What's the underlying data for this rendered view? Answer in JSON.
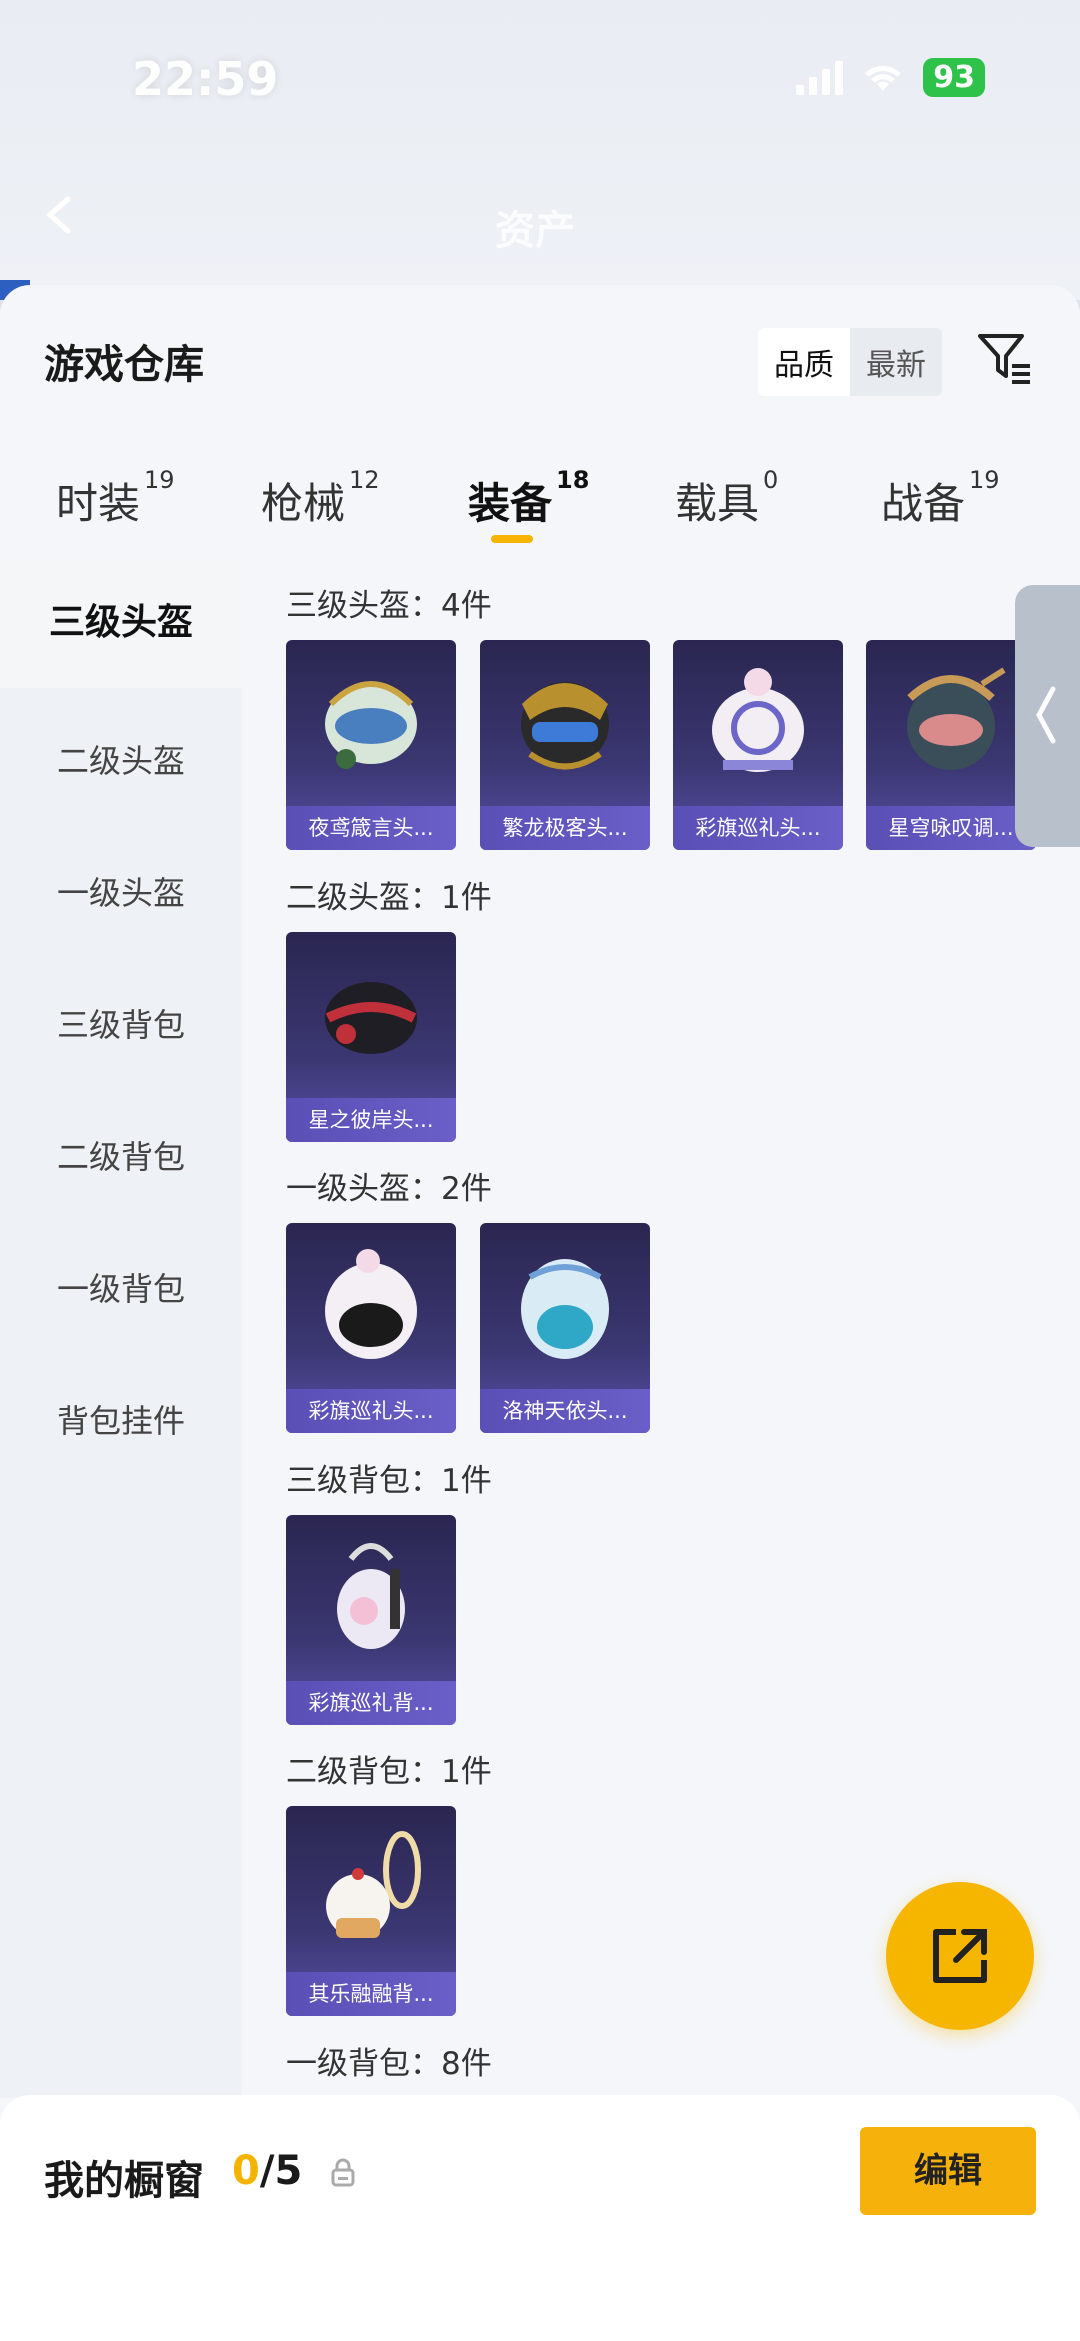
{
  "status_bar": {
    "time": "22:59",
    "battery": "93"
  },
  "top_bar": {
    "title": "资产"
  },
  "header": {
    "title": "游戏仓库",
    "sort_quality": "品质",
    "sort_latest": "最新"
  },
  "tabs": [
    {
      "label": "时装",
      "count": "19"
    },
    {
      "label": "枪械",
      "count": "12"
    },
    {
      "label": "装备",
      "count": "18"
    },
    {
      "label": "载具",
      "count": "0"
    },
    {
      "label": "战备",
      "count": "19"
    }
  ],
  "sidebar": [
    "三级头盔",
    "二级头盔",
    "一级头盔",
    "三级背包",
    "二级背包",
    "一级背包",
    "背包挂件"
  ],
  "sections": [
    {
      "title": "三级头盔：4件",
      "items": [
        "夜鸢箴言头...",
        "繁龙极客头...",
        "彩旗巡礼头...",
        "星穹咏叹调..."
      ]
    },
    {
      "title": "二级头盔：1件",
      "items": [
        "星之彼岸头..."
      ]
    },
    {
      "title": "一级头盔：2件",
      "items": [
        "彩旗巡礼头...",
        "洛神天依头..."
      ]
    },
    {
      "title": "三级背包：1件",
      "items": [
        "彩旗巡礼背..."
      ]
    },
    {
      "title": "二级背包：1件",
      "items": [
        "其乐融融背..."
      ]
    },
    {
      "title": "一级背包：8件",
      "items": []
    }
  ],
  "bottom": {
    "showcase_label": "我的橱窗",
    "count_current": "0",
    "count_total": "/5",
    "edit_label": "编辑"
  },
  "colors": {
    "accent": "#f6b20a",
    "card_caption": "#5a4fb5"
  }
}
